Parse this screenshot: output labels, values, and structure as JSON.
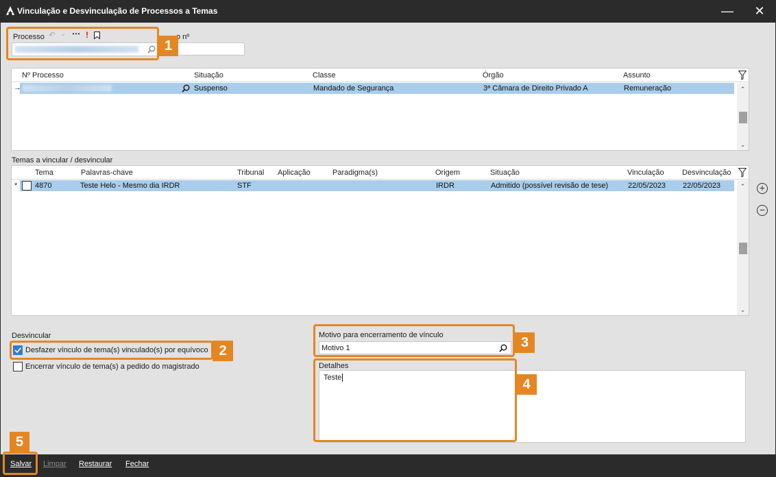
{
  "window": {
    "title": "Vinculação e Desvinculação de Processos a Temas",
    "minimize_glyph": "—",
    "close_glyph": "✕"
  },
  "processo": {
    "label": "Processo",
    "numero_label": "o nº",
    "toolbar_icons": [
      "undo-icon",
      "chevron-down-icon",
      "more-icon",
      "alert-icon",
      "bookmark-icon"
    ]
  },
  "processos_grid": {
    "columns": [
      "Nº Processo",
      "Situação",
      "Classe",
      "Órgão",
      "Assunto"
    ],
    "rows": [
      {
        "indicator": "→",
        "numero": "",
        "situacao": "Suspenso",
        "classe": "Mandado de Segurança",
        "orgao": "3ª Câmara de Direito Privado A",
        "assunto": "Remuneração"
      }
    ]
  },
  "temas": {
    "section_label": "Temas a vincular / desvincular",
    "columns": [
      "Tema",
      "Palavras-chave",
      "Tribunal",
      "Aplicação",
      "Paradigma(s)",
      "Origem",
      "Situação",
      "Vinculação",
      "Desvinculação"
    ],
    "rows": [
      {
        "indicator": "*",
        "tema": "4870",
        "palavras": "Teste Helo - Mesmo dia IRDR",
        "tribunal": "STF",
        "aplicacao": "",
        "paradigma": "",
        "origem": "IRDR",
        "situacao": "Admitido (possível revisão de tese)",
        "vinculacao": "22/05/2023",
        "desvinculacao": "22/05/2023"
      }
    ]
  },
  "desvincular": {
    "label": "Desvincular",
    "option1": "Desfazer vínculo de tema(s) vinculado(s) por equívoco",
    "option1_checked": true,
    "option2": "Encerrar vínculo de tema(s) a pedido do magistrado",
    "option2_checked": false
  },
  "motivo": {
    "label": "Motivo para encerramento de vínculo",
    "value": "Motivo 1"
  },
  "detalhes": {
    "label": "Detalhes",
    "value": "Teste"
  },
  "badges": [
    "1",
    "2",
    "3",
    "4",
    "5"
  ],
  "footer": {
    "salvar": "Salvar",
    "limpar": "Limpar",
    "restaurar": "Restaurar",
    "fechar": "Fechar"
  },
  "colors": {
    "highlight": "#e58623",
    "selected_row": "#a9cdea",
    "titlebar": "#2b2b2b",
    "background": "#e2e2e2"
  }
}
